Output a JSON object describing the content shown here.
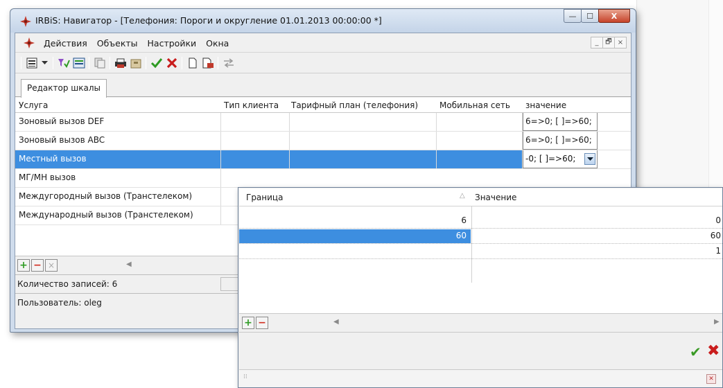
{
  "window": {
    "title": "IRBiS: Навигатор - [Телефония: Пороги и округление 01.01.2013 00:00:00 *]",
    "controls": {
      "minimize": "—",
      "maximize": "☐",
      "close": "X"
    }
  },
  "menubar": {
    "items": [
      "Действия",
      "Объекты",
      "Настройки",
      "Окна"
    ],
    "mdi_controls": [
      "_",
      "🗗",
      "×"
    ]
  },
  "toolbar": {
    "icons": [
      "view-icon",
      "dropdown-arrow-icon",
      "filter-icon",
      "table-icon",
      "copy-icon",
      "print-icon",
      "archive-icon",
      "apply-icon",
      "cancel-icon",
      "new-document-icon",
      "edit-document-icon",
      "swap-icon"
    ],
    "accent_green": "#2e9b23",
    "accent_red": "#d12b1e"
  },
  "tabs": [
    "Редактор шкалы"
  ],
  "grid": {
    "columns": [
      "Услуга",
      "Тип клиента",
      "Тарифный план (телефония)",
      "Мобильная сеть",
      "значение"
    ],
    "rows": [
      {
        "service": "Зоновый вызов DEF",
        "value": "6=>0; [ ]=>60;"
      },
      {
        "service": "Зоновый вызов ABC",
        "value": "6=>0; [ ]=>60;"
      },
      {
        "service": "Местный вызов",
        "value": "-0; [ ]=>60;"
      },
      {
        "service": "МГ/МН вызов",
        "value": ""
      },
      {
        "service": "Междугородный вызов (Транстелеком)",
        "value": ""
      },
      {
        "service": "Международный вызов (Транстелеком)",
        "value": ""
      }
    ],
    "selected_row": 2,
    "selection_color": "#3d8ee0"
  },
  "footer": {
    "add": "+",
    "remove": "−",
    "clear": "×",
    "scroll_left": "◀"
  },
  "status": {
    "records": "Количество записей: 6",
    "user": "Пользователь: oleg"
  },
  "popup": {
    "columns": [
      "Граница",
      "Значение"
    ],
    "sort_indicator": "△",
    "rows": [
      {
        "limit": "6",
        "value": "0"
      },
      {
        "limit": "60",
        "value": "60"
      },
      {
        "limit": "",
        "value": "1"
      }
    ],
    "selected_row": 1,
    "footer": {
      "add": "+",
      "remove": "−",
      "scroll_left": "◀",
      "scroll_right": "▶"
    },
    "ok": "✔",
    "cancel": "✖",
    "grip": "⁞⁞",
    "close": "✕"
  }
}
